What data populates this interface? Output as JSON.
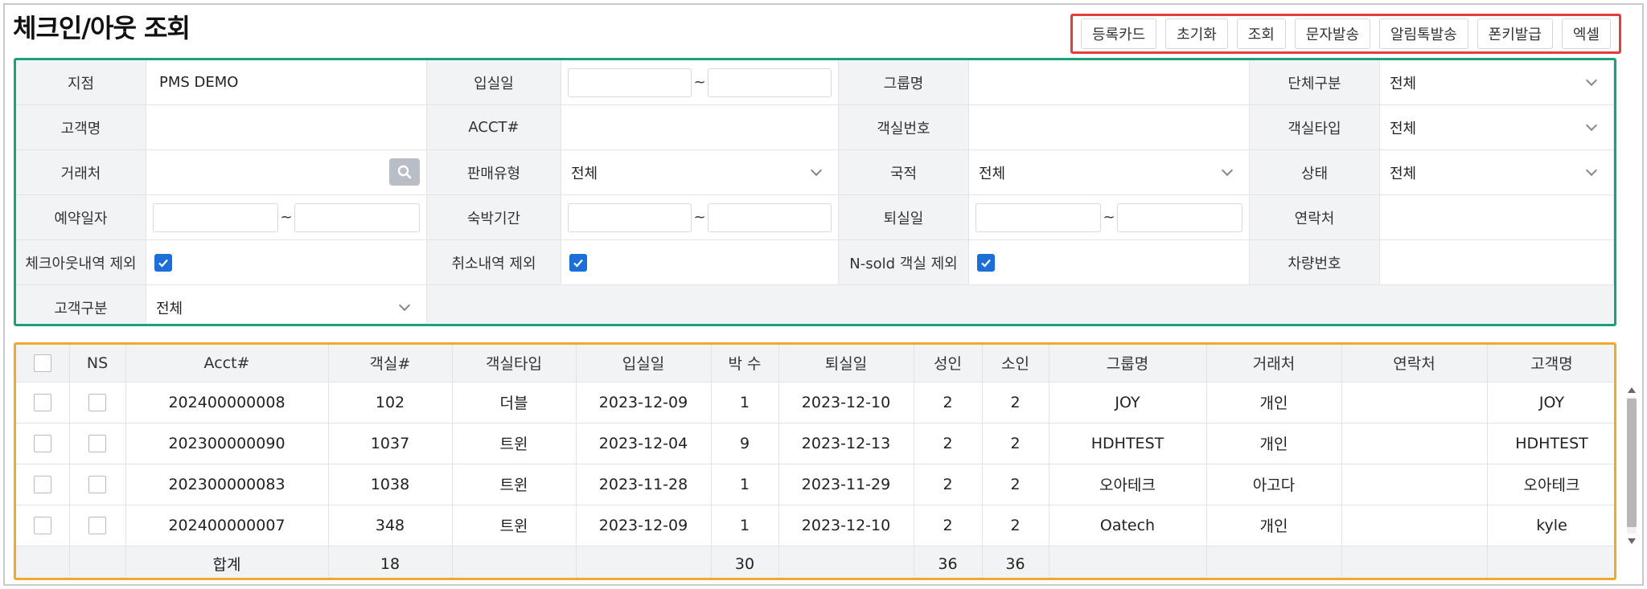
{
  "page": {
    "title": "체크인/아웃 조회"
  },
  "toolbar": {
    "buttons": [
      "등록카드",
      "초기화",
      "조회",
      "문자발송",
      "알림톡발송",
      "폰키발급",
      "엑셀"
    ]
  },
  "search": {
    "branch_label": "지점",
    "branch_value": "PMS DEMO",
    "checkin_label": "입실일",
    "group_label": "그룹명",
    "group_type_label": "단체구분",
    "group_type_value": "전체",
    "customer_label": "고객명",
    "acct_label": "ACCT#",
    "room_no_label": "객실번호",
    "room_type_label": "객실타입",
    "room_type_value": "전체",
    "vendor_label": "거래처",
    "sales_type_label": "판매유형",
    "sales_type_value": "전체",
    "nationality_label": "국적",
    "nationality_value": "전체",
    "status_label": "상태",
    "status_value": "전체",
    "reserve_date_label": "예약일자",
    "stay_period_label": "숙박기간",
    "checkout_label": "퇴실일",
    "contact_label": "연락처",
    "exclude_checkout_label": "체크아웃내역 제외",
    "exclude_cancel_label": "취소내역 제외",
    "exclude_nsold_label": "N-sold 객실 제외",
    "car_no_label": "차량번호",
    "customer_type_label": "고객구분",
    "customer_type_value": "전체",
    "tilde": "~"
  },
  "grid": {
    "headers": [
      "",
      "NS",
      "Acct#",
      "객실#",
      "객실타입",
      "입실일",
      "박 수",
      "퇴실일",
      "성인",
      "소인",
      "그룹명",
      "거래처",
      "연락처",
      "고객명"
    ],
    "rows": [
      [
        "202400000008",
        "102",
        "더블",
        "2023-12-09",
        "1",
        "2023-12-10",
        "2",
        "2",
        "JOY",
        "개인",
        "",
        "JOY"
      ],
      [
        "202300000090",
        "1037",
        "트윈",
        "2023-12-04",
        "9",
        "2023-12-13",
        "2",
        "2",
        "HDHTEST",
        "개인",
        "",
        "HDHTEST"
      ],
      [
        "202300000083",
        "1038",
        "트윈",
        "2023-11-28",
        "1",
        "2023-11-29",
        "2",
        "2",
        "오아테크",
        "아고다",
        "",
        "오아테크"
      ],
      [
        "202400000007",
        "348",
        "트윈",
        "2023-12-09",
        "1",
        "2023-12-10",
        "2",
        "2",
        "Oatech",
        "개인",
        "",
        "kyle"
      ]
    ],
    "footer": {
      "label": "합계",
      "rooms": "18",
      "nights": "30",
      "adults": "36",
      "children": "36"
    }
  },
  "colors": {
    "toolbar_border": "#e53c3c",
    "search_border": "#19a07f",
    "grid_border": "#f0a92a",
    "checkbox": "#1c6fd8"
  }
}
